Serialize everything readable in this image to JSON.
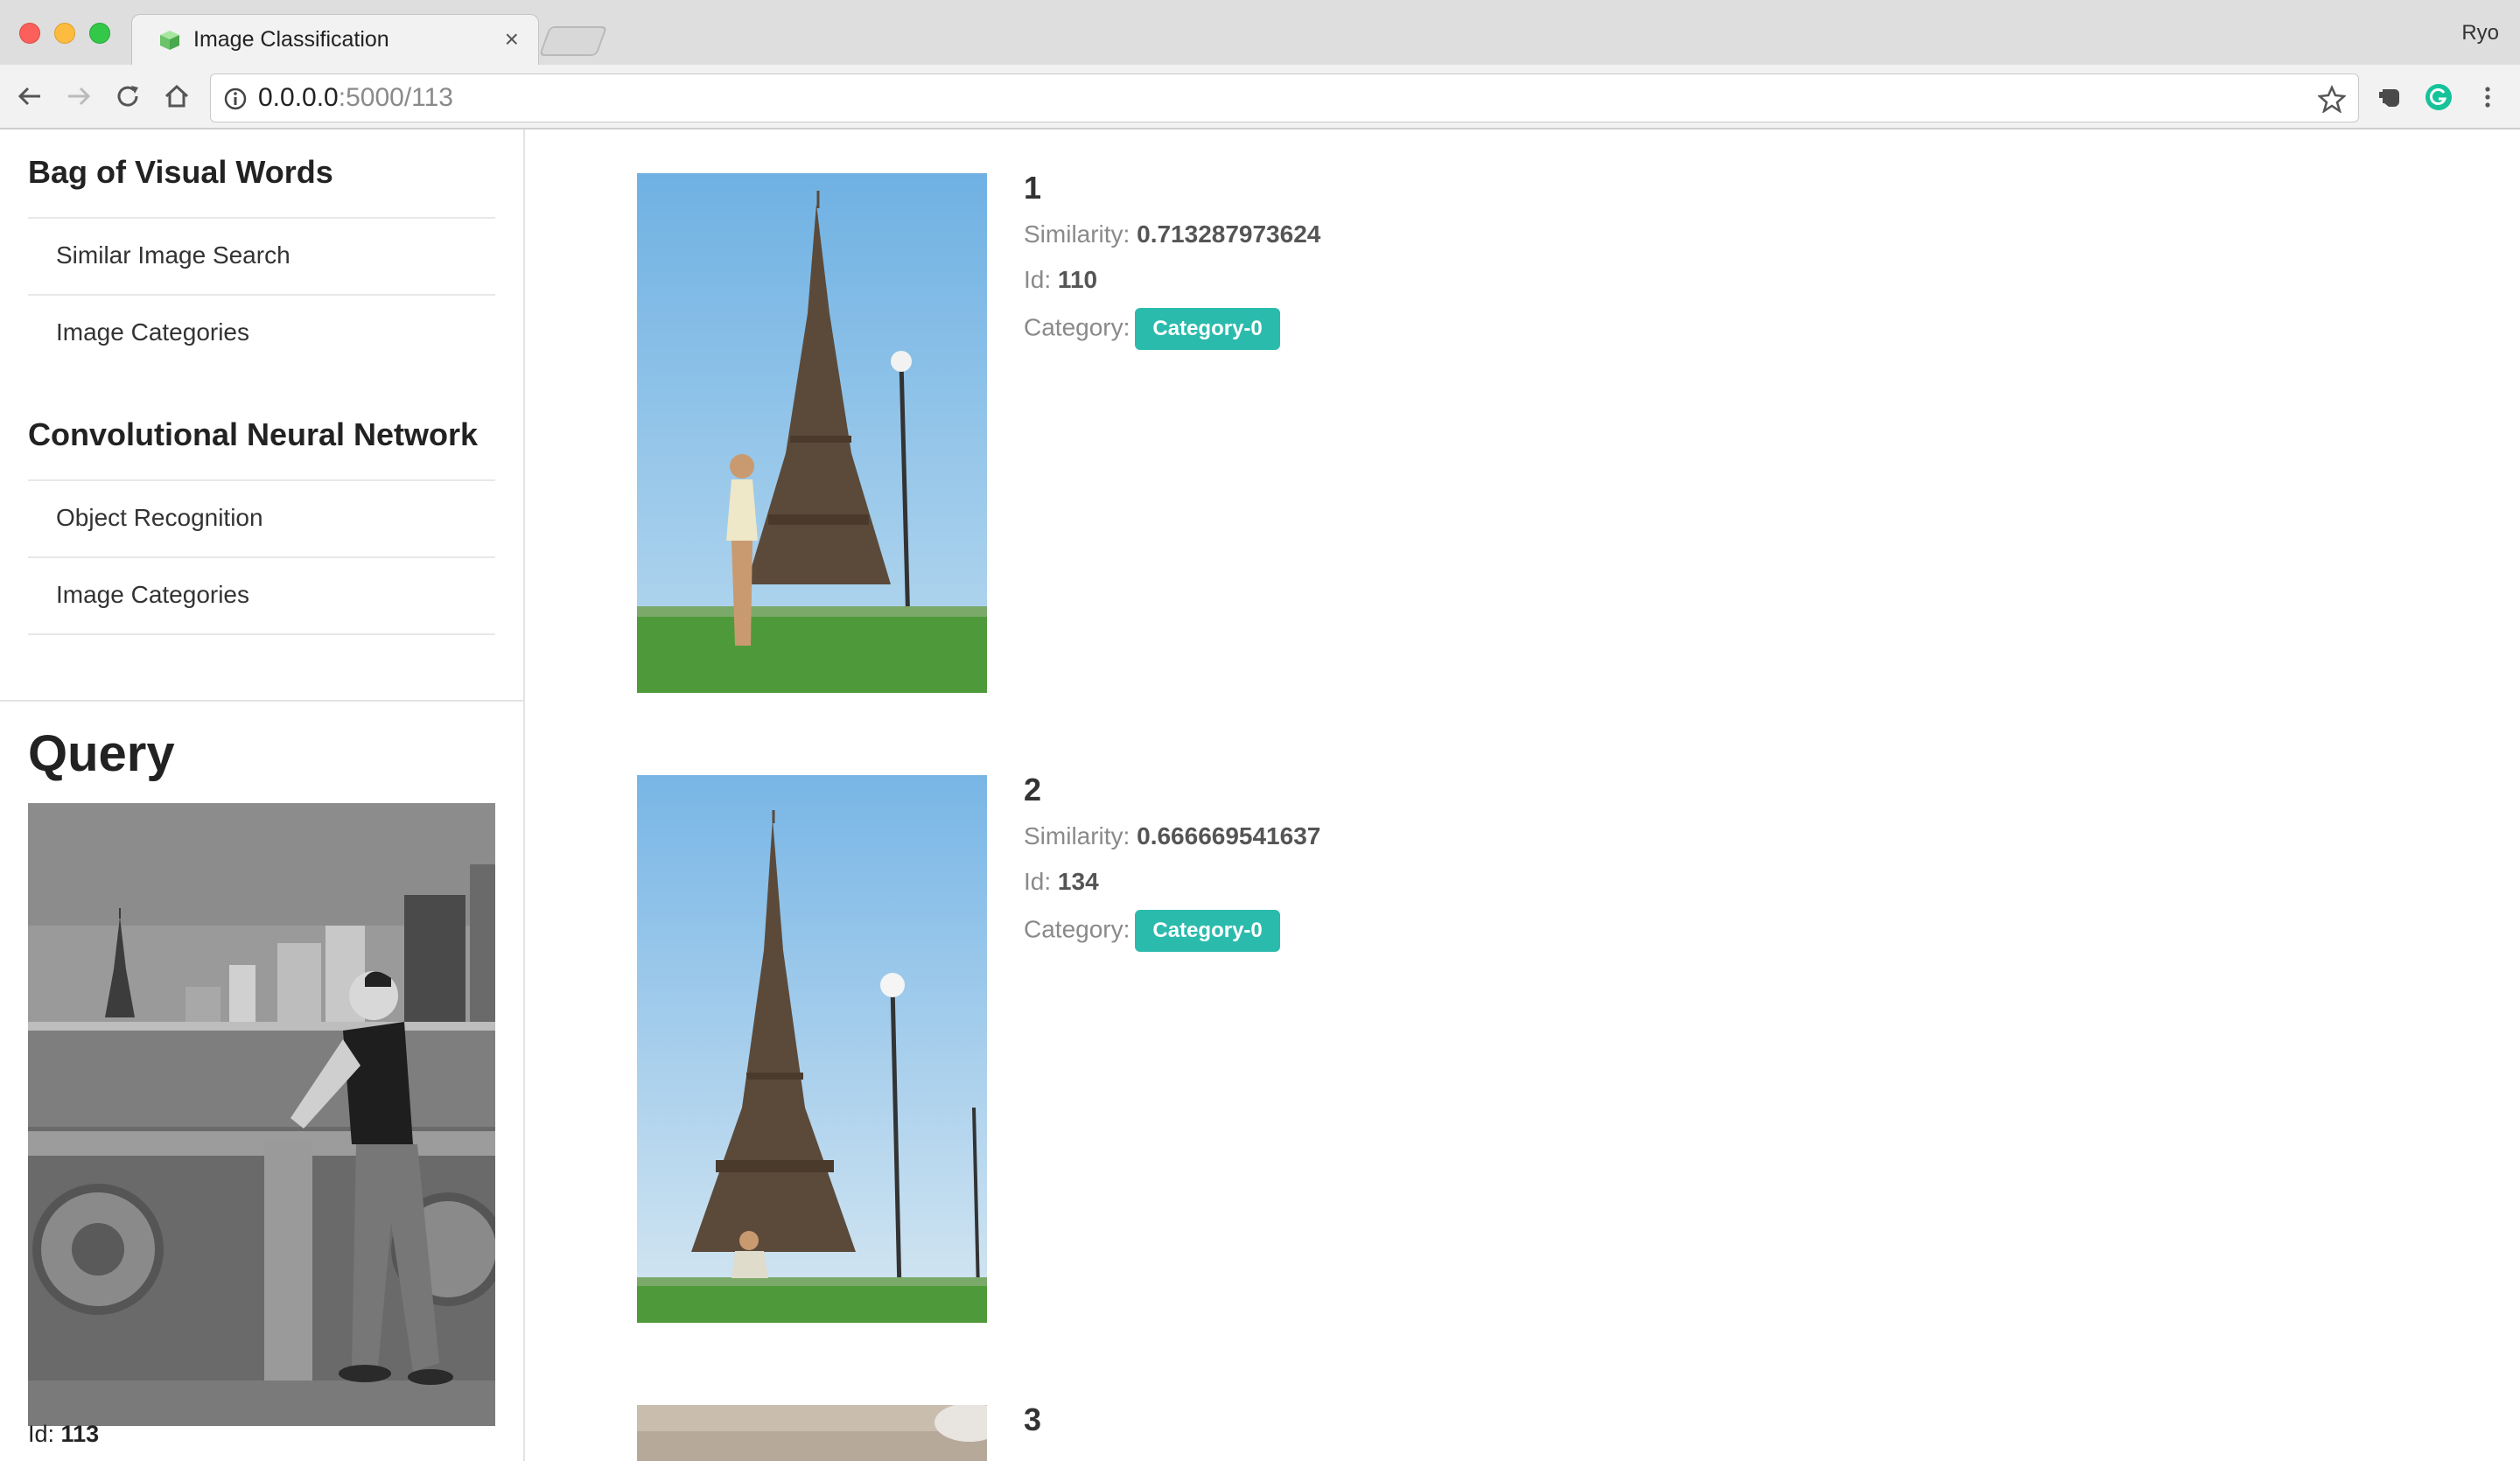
{
  "browser": {
    "tab_title": "Image Classification",
    "tab_close": "×",
    "profile_name": "Ryo",
    "url_host": "0.0.0.0",
    "url_rest": ":5000/113"
  },
  "sidebar": {
    "sections": [
      {
        "title": "Bag of Visual Words",
        "items": [
          "Similar Image Search",
          "Image Categories"
        ]
      },
      {
        "title": "Convolutional Neural Network",
        "items": [
          "Object Recognition",
          "Image Categories"
        ]
      }
    ],
    "query": {
      "title": "Query",
      "id_label": "Id:",
      "id_value": "113"
    }
  },
  "results": [
    {
      "rank": "1",
      "similarity_label": "Similarity:",
      "similarity": "0.713287973624",
      "id_label": "Id:",
      "id": "110",
      "category_label": "Category:",
      "category": "Category-0"
    },
    {
      "rank": "2",
      "similarity_label": "Similarity:",
      "similarity": "0.666669541637",
      "id_label": "Id:",
      "id": "134",
      "category_label": "Category:",
      "category": "Category-0"
    },
    {
      "rank": "3"
    }
  ],
  "colors": {
    "badge": "#2bbbad",
    "sky": "#8cc3ec",
    "grass": "#4e9a3a"
  }
}
